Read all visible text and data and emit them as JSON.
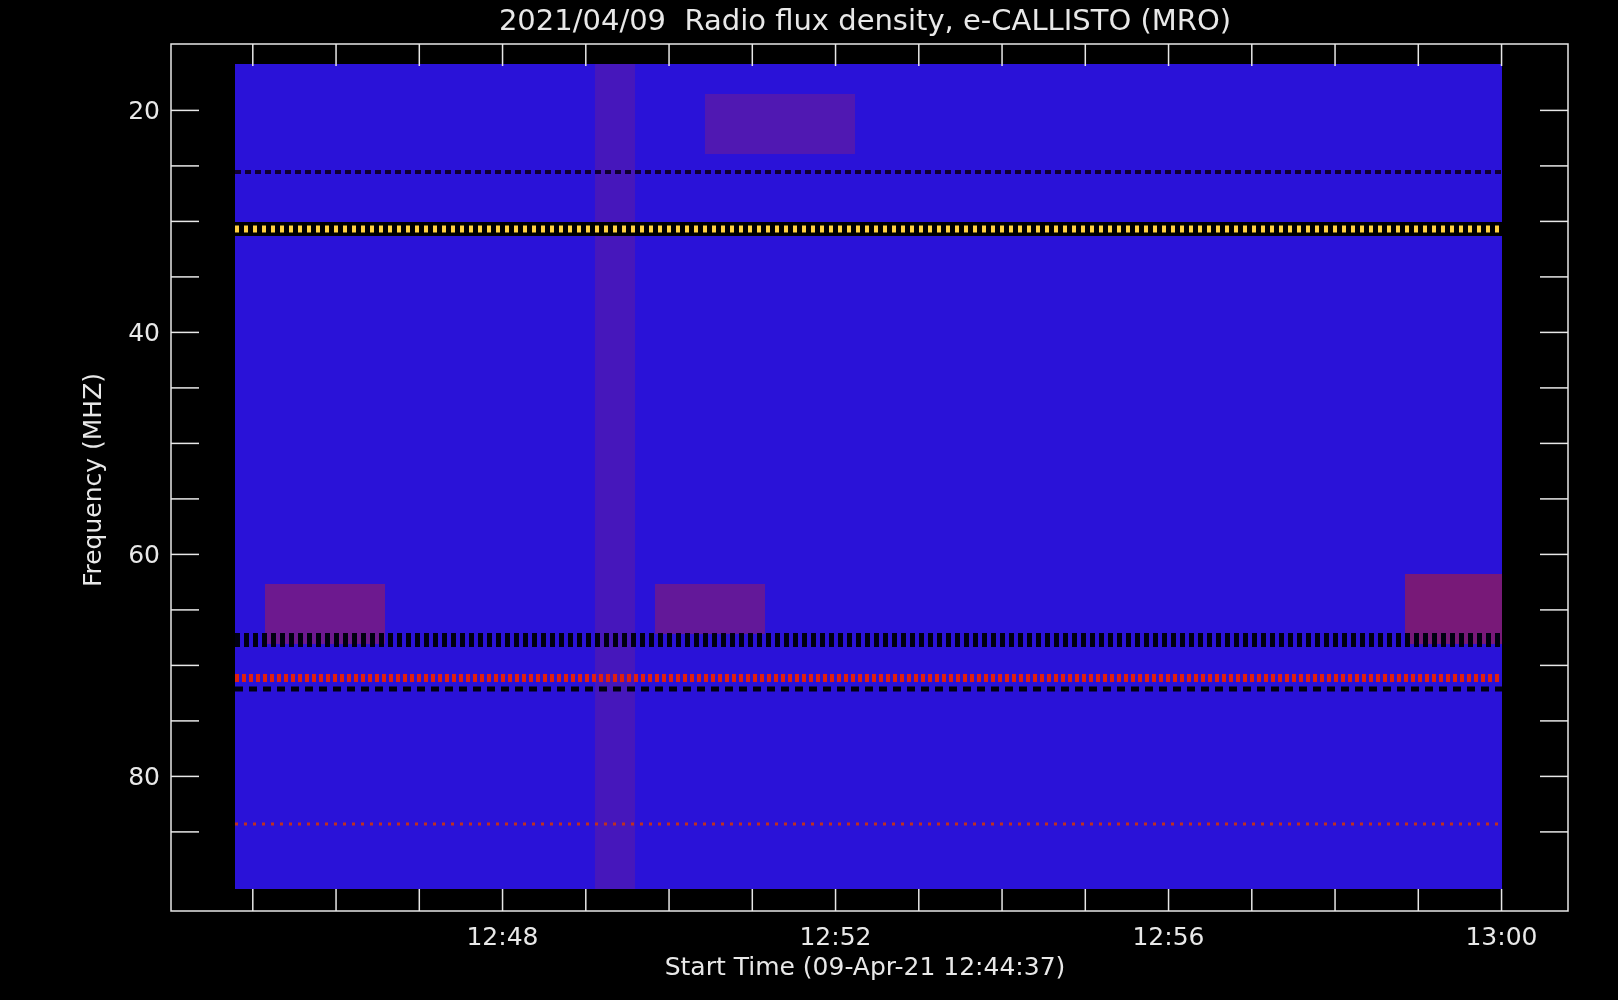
{
  "title": "2021/04/09  Radio flux density, e-CALLISTO (MRO)",
  "y_axis": {
    "label": "Frequency (MHZ)",
    "ticks": [
      "20",
      "40",
      "60",
      "80"
    ]
  },
  "x_axis": {
    "label": "Start Time (09-Apr-21 12:44:37)",
    "ticks": [
      "12:48",
      "12:52",
      "12:56",
      "13:00"
    ]
  }
}
